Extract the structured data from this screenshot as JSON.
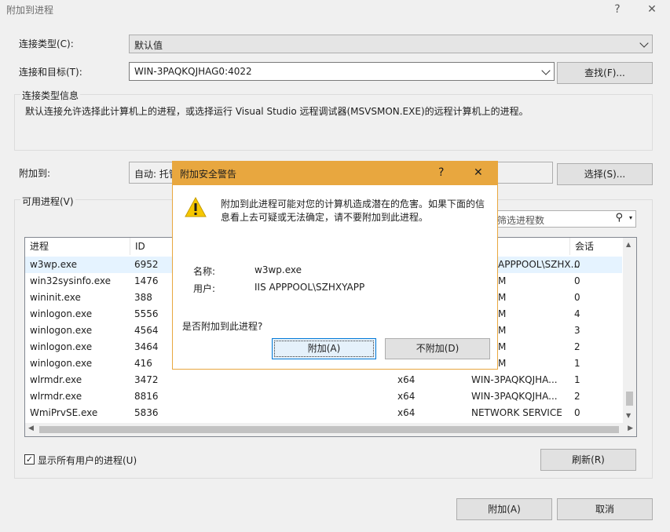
{
  "window": {
    "title": "附加到进程",
    "help": "?",
    "close": "✕"
  },
  "connection_type": {
    "label": "连接类型(C):",
    "value": "默认值"
  },
  "connection_target": {
    "label": "连接和目标(T):",
    "value": "WIN-3PAQKQJHAG0:4022",
    "find_button": "查找(F)..."
  },
  "connection_info": {
    "group_title": "连接类型信息",
    "text": "默认连接允许选择此计算机上的进程，或选择运行 Visual Studio 远程调试器(MSVSMON.EXE)的远程计算机上的进程。"
  },
  "attach_to": {
    "label": "附加到:",
    "value": "自动: 托管",
    "select_button": "选择(S)..."
  },
  "available": {
    "group_title": "可用进程(V)",
    "filter_placeholder": "筛选进程数"
  },
  "table": {
    "headers": [
      "进程",
      "ID",
      "",
      "",
      "会话"
    ],
    "rows": [
      {
        "name": "w3wp.exe",
        "id": "6952",
        "type": "",
        "user": "APPPOOL\\SZHX...",
        "session": "0"
      },
      {
        "name": "win32sysinfo.exe",
        "id": "1476",
        "type": "",
        "user": "M",
        "session": "0"
      },
      {
        "name": "wininit.exe",
        "id": "388",
        "type": "",
        "user": "M",
        "session": "0"
      },
      {
        "name": "winlogon.exe",
        "id": "5556",
        "type": "",
        "user": "M",
        "session": "4"
      },
      {
        "name": "winlogon.exe",
        "id": "4564",
        "type": "",
        "user": "M",
        "session": "3"
      },
      {
        "name": "winlogon.exe",
        "id": "3464",
        "type": "",
        "user": "M",
        "session": "2"
      },
      {
        "name": "winlogon.exe",
        "id": "416",
        "type": "",
        "user": "M",
        "session": "1"
      },
      {
        "name": "wlrmdr.exe",
        "id": "3472",
        "type": "x64",
        "user": "WIN-3PAQKQJHA...",
        "session": "1"
      },
      {
        "name": "wlrmdr.exe",
        "id": "8816",
        "type": "x64",
        "user": "WIN-3PAQKQJHA...",
        "session": "2"
      },
      {
        "name": "WmiPrvSE.exe",
        "id": "5836",
        "type": "x64",
        "user": "NETWORK SERVICE",
        "session": "0"
      }
    ]
  },
  "show_all_users": {
    "label": "显示所有用户的进程(U)",
    "checked": true
  },
  "refresh_button": "刷新(R)",
  "attach_button": "附加(A)",
  "cancel_button": "取消",
  "dialog": {
    "title": "附加安全警告",
    "help": "?",
    "close": "✕",
    "warning_line1": "附加到此进程可能对您的计算机造成潜在的危害。如果下面的信",
    "warning_line2": "息看上去可疑或无法确定，请不要附加到此进程。",
    "name_label": "名称:",
    "name_value": "w3wp.exe",
    "user_label": "用户:",
    "user_value": "IIS APPPOOL\\SZHXYAPP",
    "question": "是否附加到此进程?",
    "attach_button": "附加(A)",
    "no_attach_button": "不附加(D)"
  }
}
